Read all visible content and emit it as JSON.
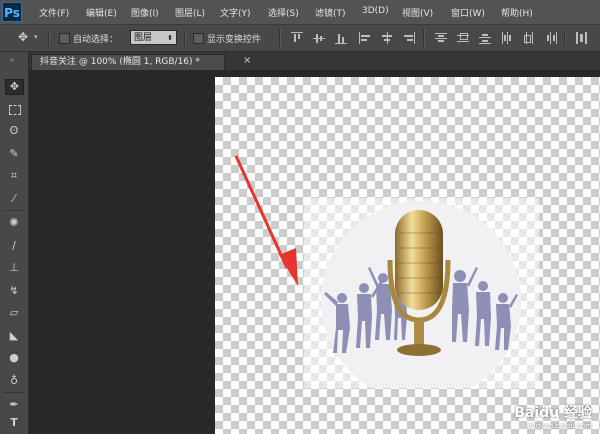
{
  "app": {
    "logo": "Ps"
  },
  "menu": [
    "文件(F)",
    "编辑(E)",
    "图像(I)",
    "图层(L)",
    "文字(Y)",
    "选择(S)",
    "滤镜(T)",
    "3D(D)",
    "视图(V)",
    "窗口(W)",
    "帮助(H)"
  ],
  "options": {
    "auto_select_label": "自动选择：",
    "auto_select_value": "图层",
    "show_transform_label": "显示变换控件"
  },
  "document": {
    "tab_title": "抖音关注 @ 100% (椭圆 1, RGB/16) *",
    "close_glyph": "×"
  },
  "watermark": {
    "main": "Baidu 经验",
    "sub": "jingyan.baidu.com"
  },
  "colors": {
    "arrow": "#e8342f",
    "menubar": "#535353",
    "workspace": "#282828"
  }
}
